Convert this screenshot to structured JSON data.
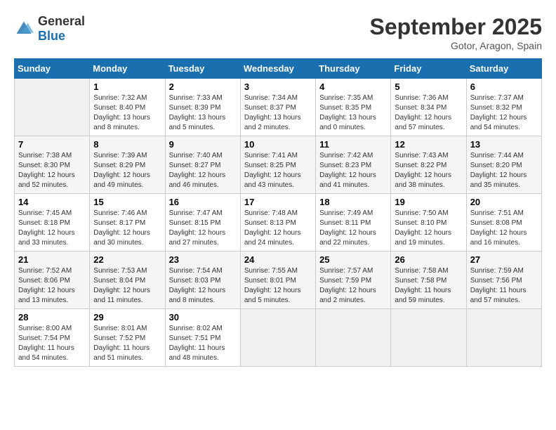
{
  "header": {
    "logo_general": "General",
    "logo_blue": "Blue",
    "month": "September 2025",
    "location": "Gotor, Aragon, Spain"
  },
  "days_of_week": [
    "Sunday",
    "Monday",
    "Tuesday",
    "Wednesday",
    "Thursday",
    "Friday",
    "Saturday"
  ],
  "weeks": [
    [
      {
        "day": "",
        "sunrise": "",
        "sunset": "",
        "daylight": "",
        "empty": true
      },
      {
        "day": "1",
        "sunrise": "Sunrise: 7:32 AM",
        "sunset": "Sunset: 8:40 PM",
        "daylight": "Daylight: 13 hours and 8 minutes.",
        "empty": false
      },
      {
        "day": "2",
        "sunrise": "Sunrise: 7:33 AM",
        "sunset": "Sunset: 8:39 PM",
        "daylight": "Daylight: 13 hours and 5 minutes.",
        "empty": false
      },
      {
        "day": "3",
        "sunrise": "Sunrise: 7:34 AM",
        "sunset": "Sunset: 8:37 PM",
        "daylight": "Daylight: 13 hours and 2 minutes.",
        "empty": false
      },
      {
        "day": "4",
        "sunrise": "Sunrise: 7:35 AM",
        "sunset": "Sunset: 8:35 PM",
        "daylight": "Daylight: 13 hours and 0 minutes.",
        "empty": false
      },
      {
        "day": "5",
        "sunrise": "Sunrise: 7:36 AM",
        "sunset": "Sunset: 8:34 PM",
        "daylight": "Daylight: 12 hours and 57 minutes.",
        "empty": false
      },
      {
        "day": "6",
        "sunrise": "Sunrise: 7:37 AM",
        "sunset": "Sunset: 8:32 PM",
        "daylight": "Daylight: 12 hours and 54 minutes.",
        "empty": false
      }
    ],
    [
      {
        "day": "7",
        "sunrise": "Sunrise: 7:38 AM",
        "sunset": "Sunset: 8:30 PM",
        "daylight": "Daylight: 12 hours and 52 minutes.",
        "empty": false
      },
      {
        "day": "8",
        "sunrise": "Sunrise: 7:39 AM",
        "sunset": "Sunset: 8:29 PM",
        "daylight": "Daylight: 12 hours and 49 minutes.",
        "empty": false
      },
      {
        "day": "9",
        "sunrise": "Sunrise: 7:40 AM",
        "sunset": "Sunset: 8:27 PM",
        "daylight": "Daylight: 12 hours and 46 minutes.",
        "empty": false
      },
      {
        "day": "10",
        "sunrise": "Sunrise: 7:41 AM",
        "sunset": "Sunset: 8:25 PM",
        "daylight": "Daylight: 12 hours and 43 minutes.",
        "empty": false
      },
      {
        "day": "11",
        "sunrise": "Sunrise: 7:42 AM",
        "sunset": "Sunset: 8:23 PM",
        "daylight": "Daylight: 12 hours and 41 minutes.",
        "empty": false
      },
      {
        "day": "12",
        "sunrise": "Sunrise: 7:43 AM",
        "sunset": "Sunset: 8:22 PM",
        "daylight": "Daylight: 12 hours and 38 minutes.",
        "empty": false
      },
      {
        "day": "13",
        "sunrise": "Sunrise: 7:44 AM",
        "sunset": "Sunset: 8:20 PM",
        "daylight": "Daylight: 12 hours and 35 minutes.",
        "empty": false
      }
    ],
    [
      {
        "day": "14",
        "sunrise": "Sunrise: 7:45 AM",
        "sunset": "Sunset: 8:18 PM",
        "daylight": "Daylight: 12 hours and 33 minutes.",
        "empty": false
      },
      {
        "day": "15",
        "sunrise": "Sunrise: 7:46 AM",
        "sunset": "Sunset: 8:17 PM",
        "daylight": "Daylight: 12 hours and 30 minutes.",
        "empty": false
      },
      {
        "day": "16",
        "sunrise": "Sunrise: 7:47 AM",
        "sunset": "Sunset: 8:15 PM",
        "daylight": "Daylight: 12 hours and 27 minutes.",
        "empty": false
      },
      {
        "day": "17",
        "sunrise": "Sunrise: 7:48 AM",
        "sunset": "Sunset: 8:13 PM",
        "daylight": "Daylight: 12 hours and 24 minutes.",
        "empty": false
      },
      {
        "day": "18",
        "sunrise": "Sunrise: 7:49 AM",
        "sunset": "Sunset: 8:11 PM",
        "daylight": "Daylight: 12 hours and 22 minutes.",
        "empty": false
      },
      {
        "day": "19",
        "sunrise": "Sunrise: 7:50 AM",
        "sunset": "Sunset: 8:10 PM",
        "daylight": "Daylight: 12 hours and 19 minutes.",
        "empty": false
      },
      {
        "day": "20",
        "sunrise": "Sunrise: 7:51 AM",
        "sunset": "Sunset: 8:08 PM",
        "daylight": "Daylight: 12 hours and 16 minutes.",
        "empty": false
      }
    ],
    [
      {
        "day": "21",
        "sunrise": "Sunrise: 7:52 AM",
        "sunset": "Sunset: 8:06 PM",
        "daylight": "Daylight: 12 hours and 13 minutes.",
        "empty": false
      },
      {
        "day": "22",
        "sunrise": "Sunrise: 7:53 AM",
        "sunset": "Sunset: 8:04 PM",
        "daylight": "Daylight: 12 hours and 11 minutes.",
        "empty": false
      },
      {
        "day": "23",
        "sunrise": "Sunrise: 7:54 AM",
        "sunset": "Sunset: 8:03 PM",
        "daylight": "Daylight: 12 hours and 8 minutes.",
        "empty": false
      },
      {
        "day": "24",
        "sunrise": "Sunrise: 7:55 AM",
        "sunset": "Sunset: 8:01 PM",
        "daylight": "Daylight: 12 hours and 5 minutes.",
        "empty": false
      },
      {
        "day": "25",
        "sunrise": "Sunrise: 7:57 AM",
        "sunset": "Sunset: 7:59 PM",
        "daylight": "Daylight: 12 hours and 2 minutes.",
        "empty": false
      },
      {
        "day": "26",
        "sunrise": "Sunrise: 7:58 AM",
        "sunset": "Sunset: 7:58 PM",
        "daylight": "Daylight: 11 hours and 59 minutes.",
        "empty": false
      },
      {
        "day": "27",
        "sunrise": "Sunrise: 7:59 AM",
        "sunset": "Sunset: 7:56 PM",
        "daylight": "Daylight: 11 hours and 57 minutes.",
        "empty": false
      }
    ],
    [
      {
        "day": "28",
        "sunrise": "Sunrise: 8:00 AM",
        "sunset": "Sunset: 7:54 PM",
        "daylight": "Daylight: 11 hours and 54 minutes.",
        "empty": false
      },
      {
        "day": "29",
        "sunrise": "Sunrise: 8:01 AM",
        "sunset": "Sunset: 7:52 PM",
        "daylight": "Daylight: 11 hours and 51 minutes.",
        "empty": false
      },
      {
        "day": "30",
        "sunrise": "Sunrise: 8:02 AM",
        "sunset": "Sunset: 7:51 PM",
        "daylight": "Daylight: 11 hours and 48 minutes.",
        "empty": false
      },
      {
        "day": "",
        "sunrise": "",
        "sunset": "",
        "daylight": "",
        "empty": true
      },
      {
        "day": "",
        "sunrise": "",
        "sunset": "",
        "daylight": "",
        "empty": true
      },
      {
        "day": "",
        "sunrise": "",
        "sunset": "",
        "daylight": "",
        "empty": true
      },
      {
        "day": "",
        "sunrise": "",
        "sunset": "",
        "daylight": "",
        "empty": true
      }
    ]
  ]
}
